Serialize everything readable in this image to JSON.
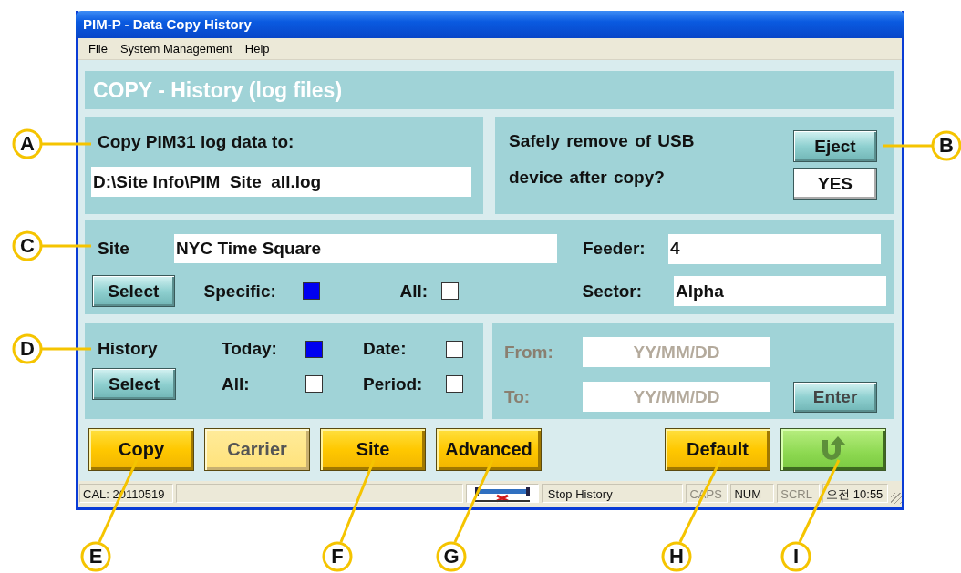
{
  "window": {
    "title": "PIM-P - Data Copy History"
  },
  "menu": [
    {
      "label": "File"
    },
    {
      "label": "System Management"
    },
    {
      "label": "Help"
    }
  ],
  "header": "COPY - History (log files)",
  "copy_target": {
    "label": "Copy PIM31 log data to:",
    "value": "D:\\Site Info\\PIM_Site_all.log"
  },
  "usb": {
    "question_lines": [
      "Safely remove of USB",
      "device after copy?"
    ],
    "eject_button": "Eject",
    "answer_button": "YES"
  },
  "site": {
    "label": "Site",
    "value": "NYC Time Square",
    "select_button": "Select",
    "options": [
      {
        "label": "Specific:",
        "checked": true
      },
      {
        "label": "All:",
        "checked": false
      }
    ],
    "feeder_label": "Feeder:",
    "feeder": "4",
    "sector_label": "Sector:",
    "sector": "Alpha"
  },
  "history": {
    "label": "History",
    "select_button": "Select",
    "options": [
      {
        "label": "Today:",
        "checked": true
      },
      {
        "label": "Date:",
        "checked": false
      },
      {
        "label": "All:",
        "checked": false
      },
      {
        "label": "Period:",
        "checked": false
      }
    ],
    "range": {
      "disabled": true,
      "from_label": "From:",
      "from_placeholder": "YY/MM/DD",
      "to_label": "To:",
      "to_placeholder": "YY/MM/DD",
      "enter_button": "Enter"
    }
  },
  "buttons": [
    {
      "kind": "text",
      "label": "Copy",
      "disabled": false
    },
    {
      "kind": "text",
      "label": "Carrier",
      "disabled": true
    },
    {
      "kind": "text",
      "label": "Site",
      "disabled": false
    },
    {
      "kind": "text",
      "label": "Advanced",
      "disabled": false
    },
    {
      "kind": "text",
      "label": "Default",
      "disabled": false
    },
    {
      "kind": "return",
      "disabled": false
    }
  ],
  "status_bar": [
    {
      "kind": "text",
      "text": "CAL: 20110519",
      "disabled": false
    },
    {
      "kind": "blank"
    },
    {
      "kind": "picture"
    },
    {
      "kind": "text",
      "text": "Stop History",
      "disabled": false
    },
    {
      "kind": "text",
      "text": "CAPS",
      "disabled": true
    },
    {
      "kind": "text",
      "text": "NUM",
      "disabled": false
    },
    {
      "kind": "text",
      "text": "SCRL",
      "disabled": true
    },
    {
      "kind": "text",
      "text": "오전 10:55",
      "disabled": false
    }
  ],
  "callouts": [
    "A",
    "B",
    "C",
    "D",
    "E",
    "F",
    "G",
    "H",
    "I"
  ]
}
